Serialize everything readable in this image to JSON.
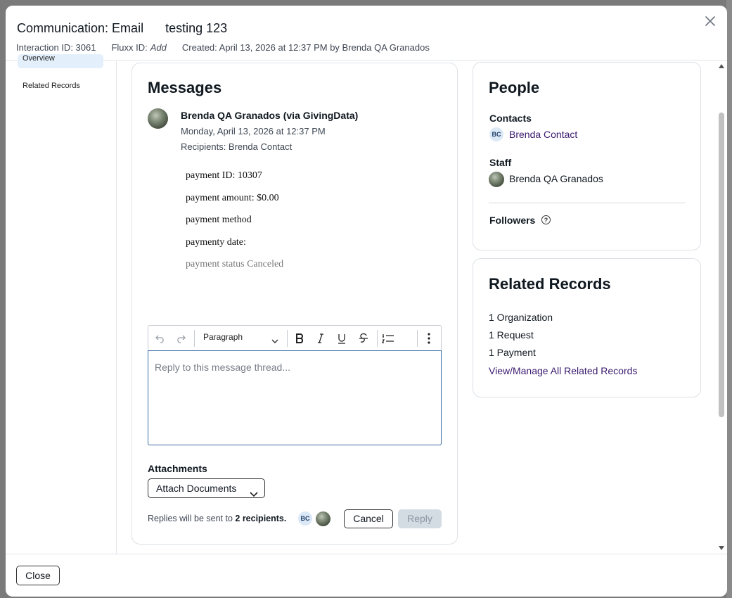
{
  "header": {
    "title": "Communication: Email",
    "subject": "testing 123",
    "interaction_id": "Interaction ID: 3061",
    "fluxx_id_label": "Fluxx ID:",
    "fluxx_id_value": "Add",
    "created": "Created: April 13, 2026 at 12:37 PM by Brenda QA Granados",
    "close_icon": "close-icon"
  },
  "sidenav": {
    "active_item": "Overview",
    "items": [
      "Related Records"
    ]
  },
  "messages": {
    "heading": "Messages",
    "sender": "Brenda QA Granados (via GivingData)",
    "date": "Monday, April 13, 2026 at 12:37 PM",
    "recipients": "Recipients: Brenda Contact",
    "body_lines": [
      "payment ID: 10307",
      "payment amount: $0.00",
      "payment method",
      "paymenty date:",
      "payment status Canceled"
    ],
    "editor": {
      "block_format": "Paragraph",
      "placeholder": "Reply to this message thread..."
    },
    "attachments_label": "Attachments",
    "attach_button": "Attach Documents",
    "replies_note_prefix": "Replies will be sent to",
    "replies_note_count": "2 recipients.",
    "recipient_badge": "BC",
    "cancel_label": "Cancel",
    "reply_label": "Reply"
  },
  "people": {
    "heading": "People",
    "contacts_label": "Contacts",
    "contact_initials": "BC",
    "contact_name": "Brenda Contact",
    "staff_label": "Staff",
    "staff_name": "Brenda QA Granados",
    "followers_label": "Followers",
    "help_glyph": "?"
  },
  "related": {
    "heading": "Related Records",
    "lines": [
      "1 Organization",
      "1 Request",
      "1 Payment"
    ],
    "link": "View/Manage All Related Records"
  },
  "footer": {
    "close_label": "Close"
  },
  "colors": {
    "link": "#3a1a6e",
    "focus_border": "#3a6ea5",
    "nav_active_bg": "#e3effa",
    "disabled_button_bg": "#d3dbe3"
  }
}
